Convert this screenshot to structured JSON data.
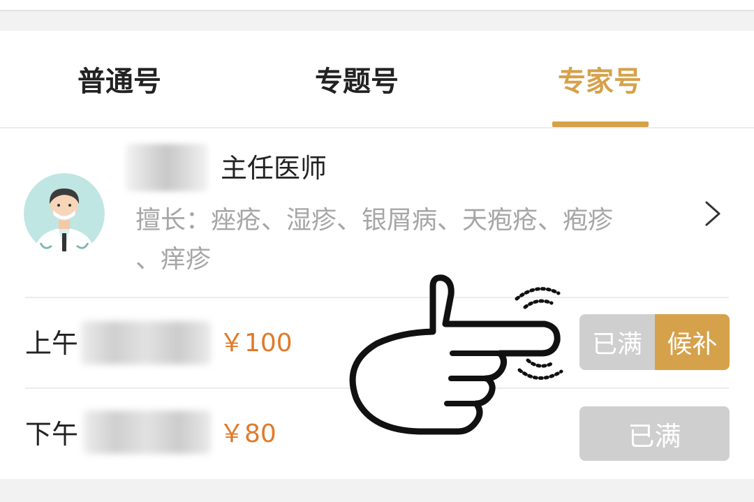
{
  "tabs": [
    {
      "label": "普通号",
      "active": false
    },
    {
      "label": "专题号",
      "active": false
    },
    {
      "label": "专家号",
      "active": true
    }
  ],
  "colors": {
    "accent": "#d5a14a",
    "price": "#e07a2a",
    "muted_button": "#cfcfcf",
    "text": "#222222",
    "subtext": "#a6a6a6"
  },
  "doctor": {
    "title": "主任医师",
    "specialty_line1": "擅长：痤疮、湿疹、银屑病、天疱疮、疱疹",
    "specialty_line2": "、痒疹"
  },
  "slots": [
    {
      "period": "上午",
      "price": "￥100",
      "status_label": "已满",
      "waitlist_label": "候补"
    },
    {
      "period": "下午",
      "price": "￥80",
      "status_label": "已满"
    }
  ]
}
